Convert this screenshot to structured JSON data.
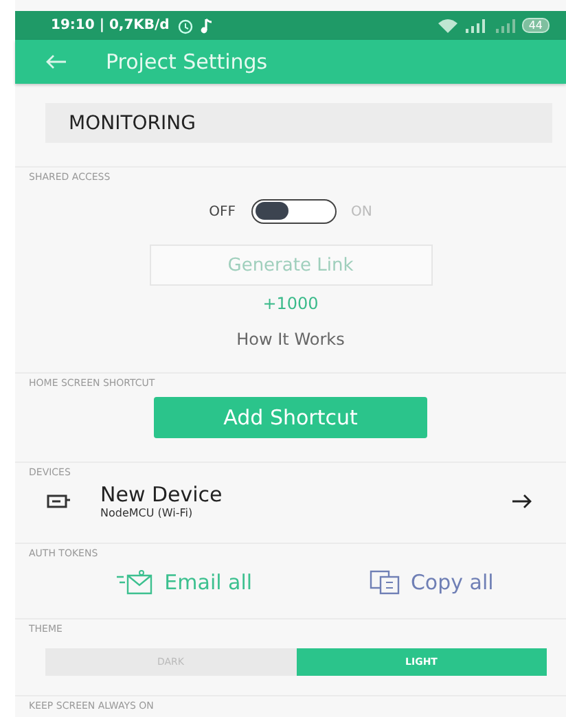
{
  "status_bar": {
    "text": "19:10 | 0,7KB/d",
    "battery": "44"
  },
  "app_bar": {
    "title": "Project Settings"
  },
  "project_name": {
    "value": "MONITORING"
  },
  "shared_access": {
    "label": "SHARED ACCESS",
    "off_label": "OFF",
    "on_label": "ON",
    "on": false,
    "generate_link": {
      "label": "Generate Link",
      "disabled": true
    },
    "energy": "+1000",
    "how_it_works": "How It Works"
  },
  "home_screen_shortcut": {
    "label": "HOME SCREEN SHORTCUT",
    "button": "Add Shortcut"
  },
  "devices": {
    "label": "DEVICES",
    "items": [
      {
        "name": "New Device",
        "type": "NodeMCU (Wi-Fi)"
      }
    ]
  },
  "auth_tokens": {
    "label": "AUTH TOKENS",
    "email": "Email all",
    "copy": "Copy all"
  },
  "theme": {
    "label": "THEME",
    "options": [
      {
        "label": "DARK",
        "selected": false
      },
      {
        "label": "LIGHT",
        "selected": true
      }
    ]
  },
  "keep_screen": {
    "label": "KEEP SCREEN ALWAYS ON"
  }
}
